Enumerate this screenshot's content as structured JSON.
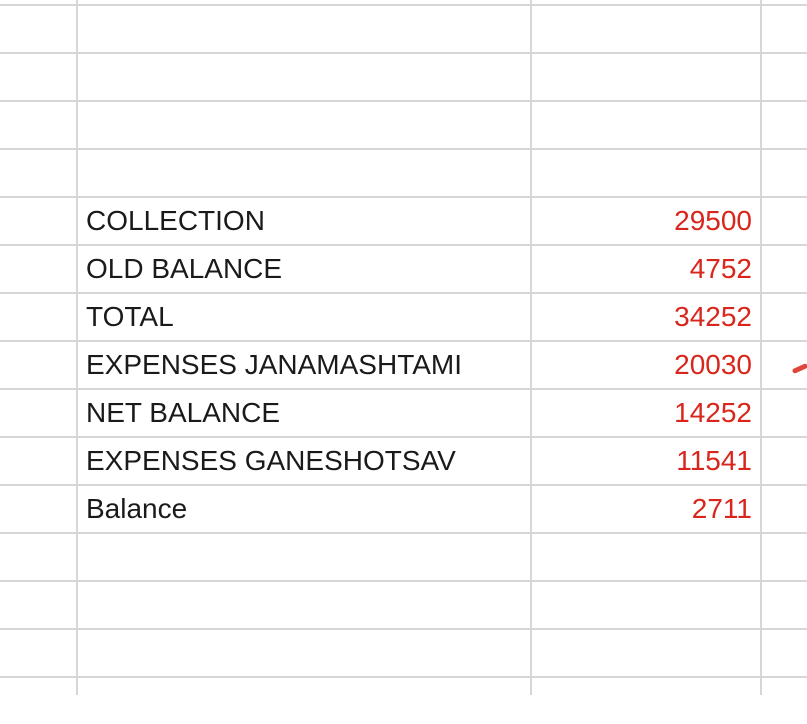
{
  "sheet": {
    "value_color": "#d9261c",
    "rows": [
      {
        "label": "",
        "value": ""
      },
      {
        "label": "",
        "value": ""
      },
      {
        "label": "",
        "value": ""
      },
      {
        "label": "",
        "value": ""
      },
      {
        "label": "COLLECTION",
        "value": "29500"
      },
      {
        "label": "OLD BALANCE",
        "value": "4752"
      },
      {
        "label": "TOTAL",
        "value": "34252"
      },
      {
        "label": "EXPENSES JANAMASHTAMI",
        "value": "20030"
      },
      {
        "label": "NET BALANCE",
        "value": "14252"
      },
      {
        "label": "EXPENSES GANESHOTSAV",
        "value": "11541"
      },
      {
        "label": "Balance",
        "value": "2711"
      },
      {
        "label": "",
        "value": ""
      },
      {
        "label": "",
        "value": ""
      },
      {
        "label": "",
        "value": ""
      }
    ]
  }
}
